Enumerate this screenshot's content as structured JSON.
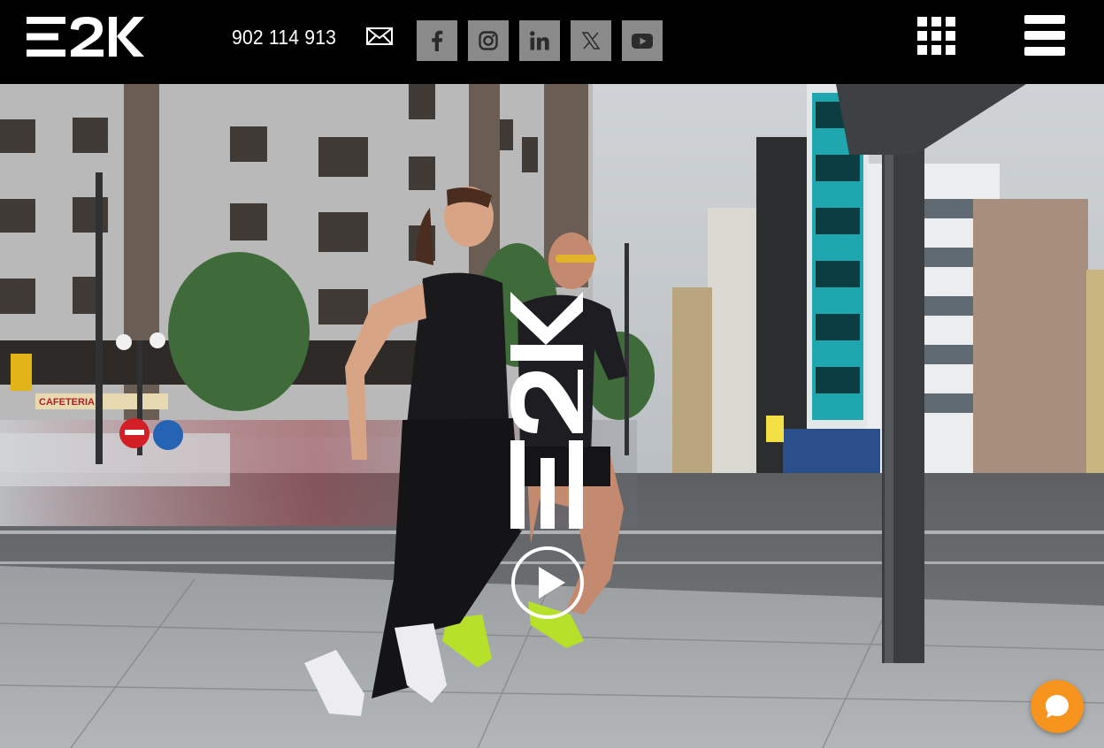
{
  "brand": {
    "logo_text": "E2K",
    "watermark_text": "E2K"
  },
  "header": {
    "phone": "902 114 913",
    "icons": {
      "mail": "mail-icon",
      "facebook": "facebook-icon",
      "instagram": "instagram-icon",
      "linkedin": "linkedin-icon",
      "x": "x-twitter-icon",
      "youtube": "youtube-icon",
      "apps": "grid-icon",
      "menu": "hamburger-menu-icon"
    }
  },
  "hero": {
    "storefront_sign": "CAFETERIA",
    "play_icon": "play-icon",
    "chat_icon": "chat-icon"
  },
  "colors": {
    "header_bg": "#000000",
    "social_bg": "#8a8a8a",
    "chat_accent": "#f7941d",
    "shoe_accent": "#b6e02a"
  }
}
